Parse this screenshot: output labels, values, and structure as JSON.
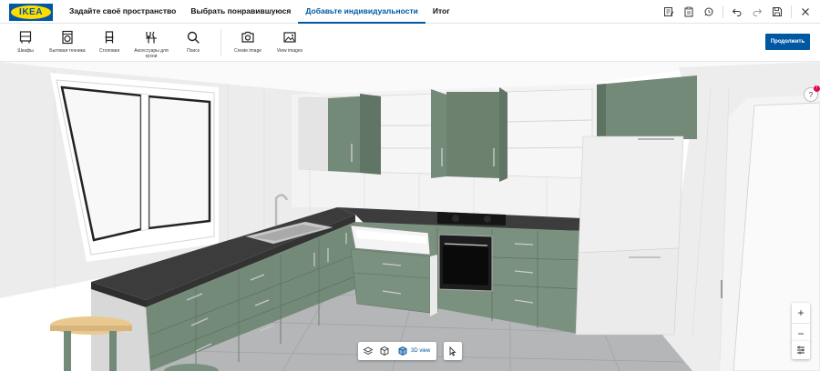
{
  "header": {
    "logo_text": "IKEA",
    "steps": [
      {
        "label": "Задайте своё пространство",
        "active": false
      },
      {
        "label": "Выбрать понравившуюся",
        "active": false
      },
      {
        "label": "Добавьте индивидуальности",
        "active": true
      },
      {
        "label": "Итог",
        "active": false
      }
    ],
    "actions": [
      "notes-icon",
      "clipboard-icon",
      "find-icon",
      "undo-icon",
      "redo-icon",
      "save-icon",
      "close-icon"
    ]
  },
  "toolbar": {
    "tools": [
      {
        "label": "Шкафы",
        "icon": "cabinet-icon"
      },
      {
        "label": "Бытовая техника",
        "icon": "appliance-icon"
      },
      {
        "label": "Столовая",
        "icon": "chair-icon"
      },
      {
        "label": "Аксессуары для кухни",
        "icon": "utensils-icon"
      },
      {
        "label": "Поиск",
        "icon": "search-icon"
      }
    ],
    "media_tools": [
      {
        "label": "Create image",
        "icon": "camera-icon"
      },
      {
        "label": "View images",
        "icon": "image-icon"
      }
    ],
    "continue_label": "Продолжить"
  },
  "viewport": {
    "view_mode_label": "3D view",
    "zoom_in": "+",
    "zoom_out": "−",
    "help_badge": "!"
  },
  "colors": {
    "accent": "#0058a3",
    "logo_yellow": "#ffdb00",
    "cabinet_green": "#748a78",
    "countertop": "#4a4a4a",
    "wall": "#f0f0f0"
  }
}
